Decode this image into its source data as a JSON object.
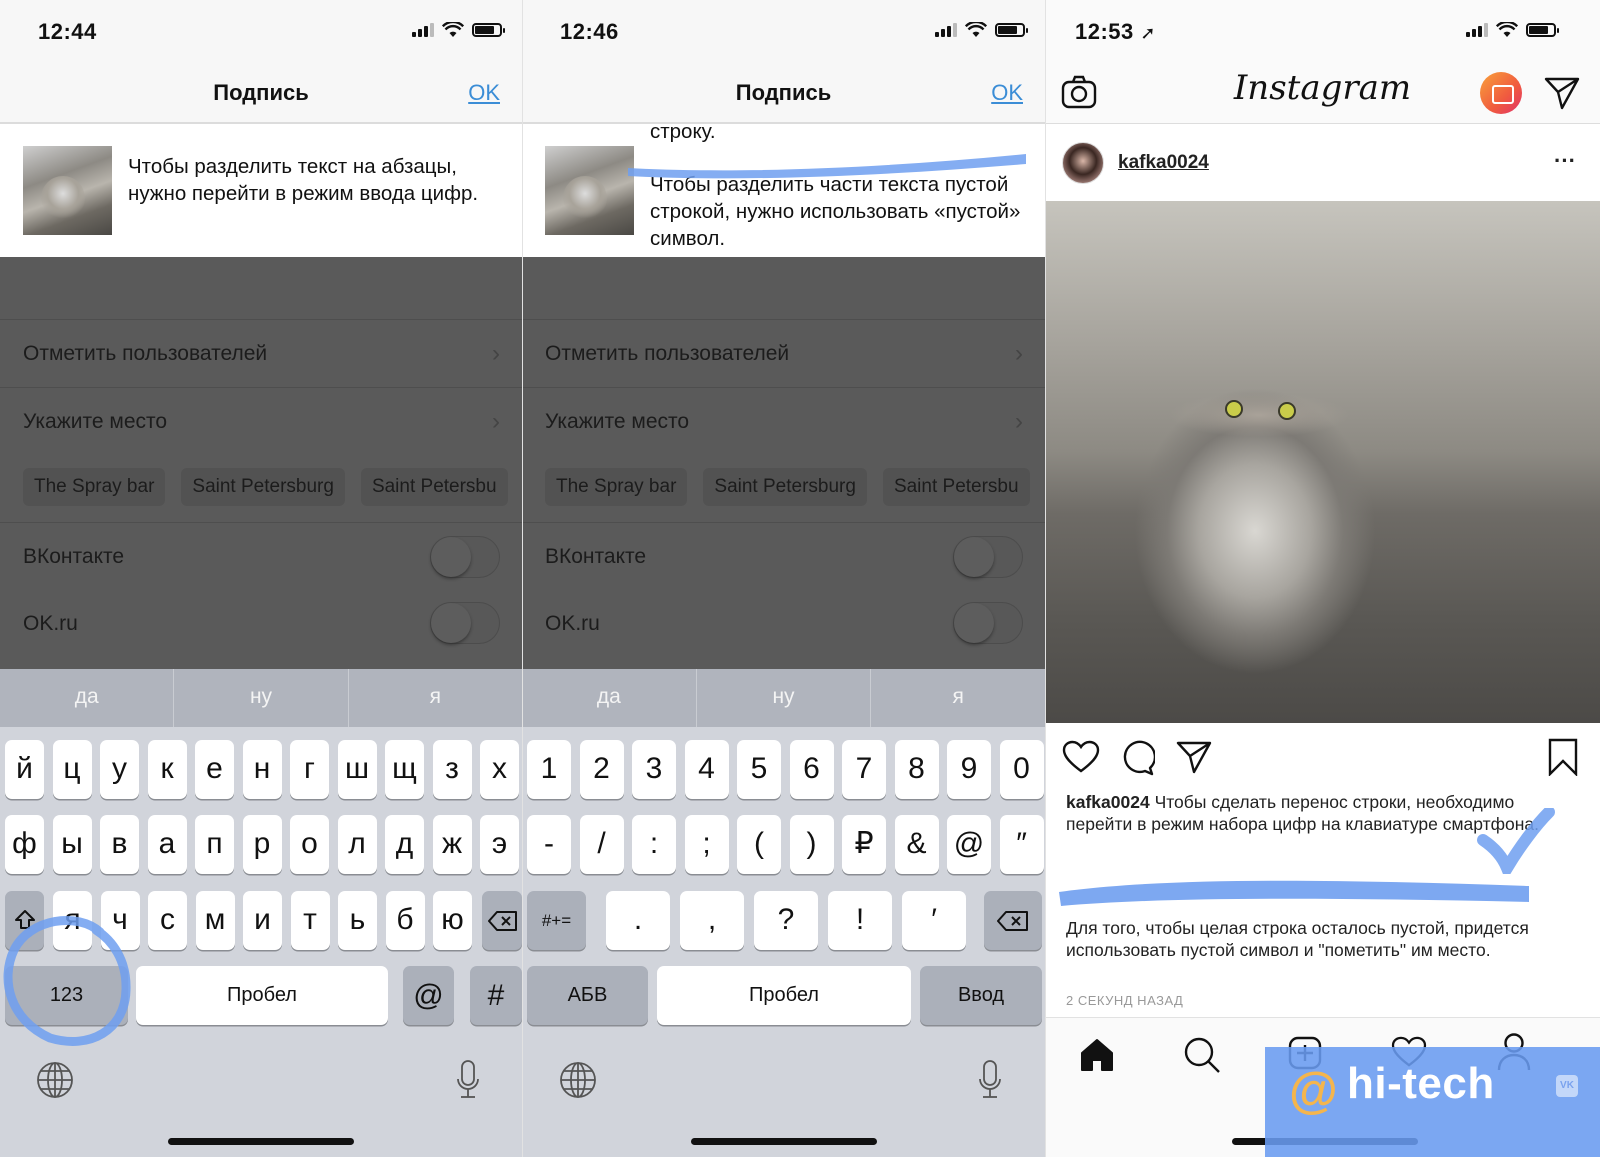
{
  "panels": [
    {
      "status": {
        "time": "12:44"
      },
      "nav": {
        "title": "Подпись",
        "ok": "OK"
      },
      "caption": {
        "text": "Чтобы разделить текст на абзацы, нужно перейти в режим ввода цифр."
      },
      "rows": {
        "tag_users": "Отметить пользователей",
        "location": "Укажите место"
      },
      "chips": [
        "The Spray bar",
        "Saint Petersburg",
        "Saint Petersbu"
      ],
      "share": [
        {
          "label": "ВКонтакте",
          "on": false
        },
        {
          "label": "OK.ru",
          "on": false
        }
      ],
      "suggestions": [
        "да",
        "ну",
        "я"
      ],
      "keyboard": {
        "mode": "letters",
        "row1": [
          "й",
          "ц",
          "у",
          "к",
          "е",
          "н",
          "г",
          "ш",
          "щ",
          "з",
          "х"
        ],
        "row2": [
          "ф",
          "ы",
          "в",
          "а",
          "п",
          "р",
          "о",
          "л",
          "д",
          "ж",
          "э"
        ],
        "row3": [
          "я",
          "ч",
          "с",
          "м",
          "и",
          "т",
          "ь",
          "б",
          "ю"
        ],
        "numbers_key": "123",
        "space": "Пробел",
        "at": "@",
        "hash": "#"
      }
    },
    {
      "status": {
        "time": "12:46"
      },
      "nav": {
        "title": "Подпись",
        "ok": "OK"
      },
      "caption": {
        "text_top": "строку.",
        "text_bottom": "Чтобы разделить части текста пустой строкой, нужно использовать «пустой» символ."
      },
      "rows": {
        "tag_users": "Отметить пользователей",
        "location": "Укажите место"
      },
      "chips": [
        "The Spray bar",
        "Saint Petersburg",
        "Saint Petersbu"
      ],
      "share": [
        {
          "label": "ВКонтакте",
          "on": false
        },
        {
          "label": "OK.ru",
          "on": false
        }
      ],
      "suggestions": [
        "да",
        "ну",
        "я"
      ],
      "keyboard": {
        "mode": "numbers",
        "row1": [
          "1",
          "2",
          "3",
          "4",
          "5",
          "6",
          "7",
          "8",
          "9",
          "0"
        ],
        "row2": [
          "-",
          "/",
          ":",
          ";",
          "(",
          ")",
          "₽",
          "&",
          "@",
          "″"
        ],
        "row3": [
          ".",
          ",",
          "?",
          "!",
          "′"
        ],
        "symbols_key": "#+=",
        "letters_key": "АБВ",
        "space": "Пробел",
        "return": "Ввод"
      }
    }
  ],
  "instagram": {
    "status": {
      "time": "12:53"
    },
    "logo": "Instagram",
    "post": {
      "username": "kafka0024",
      "caption_user": "kafka0024",
      "caption_line1": "Чтобы сделать перенос строки, необходимо перейти в режим набора цифр на клавиатуре смартфона.",
      "caption_line2": "Для того, чтобы целая строка осталось пустой, придется использовать пустой символ и \"пометить\" им    место.",
      "time_ago": "2 СЕКУНД НАЗАД"
    },
    "tabs": [
      "home",
      "search",
      "new-post",
      "activity",
      "profile"
    ]
  },
  "watermark": {
    "text": "hi-tech",
    "at": "@",
    "vk": "VK"
  },
  "colors": {
    "link": "#3b8dd6",
    "annotation": "#6f9ff0",
    "overlay": "#5a5a5a",
    "keyboard_bg": "#d1d4db"
  }
}
